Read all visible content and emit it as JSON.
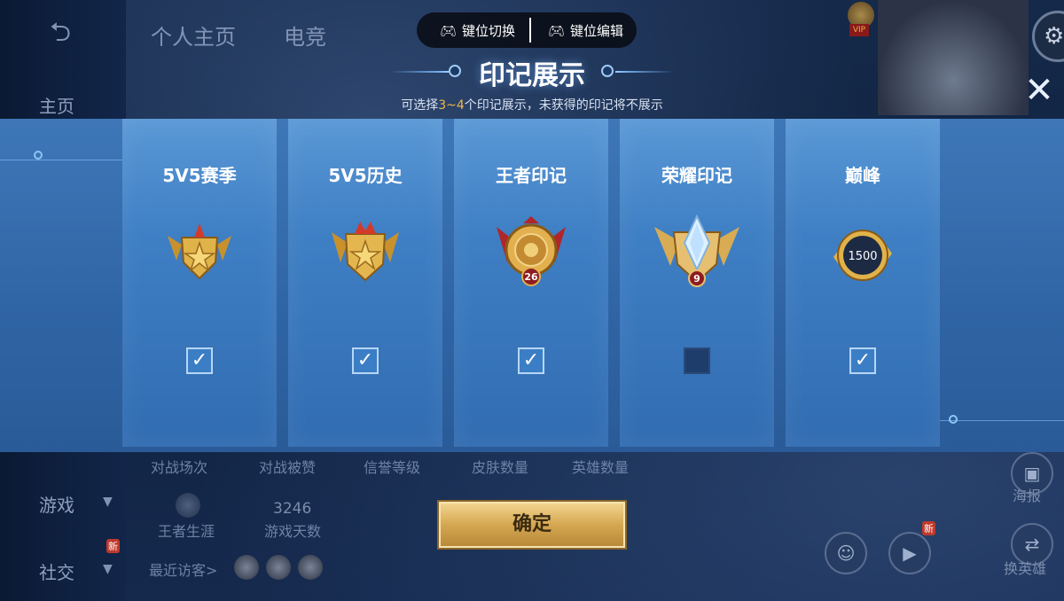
{
  "toolbar": {
    "key_switch_label": "键位切换",
    "key_edit_label": "键位编辑"
  },
  "dialog": {
    "title": "印记展示",
    "subtitle_prefix": "可选择",
    "subtitle_highlight": "3~4",
    "subtitle_suffix": "个印记展示，未获得的印记将不展示",
    "confirm_label": "确定"
  },
  "emblems": [
    {
      "label": "5V5赛季",
      "checked": true,
      "icon": "gold-crown-shield-icon"
    },
    {
      "label": "5V5历史",
      "checked": true,
      "icon": "gold-star-shield-icon"
    },
    {
      "label": "王者印记",
      "checked": true,
      "icon": "king-emblem-icon",
      "number": "26"
    },
    {
      "label": "荣耀印记",
      "checked": false,
      "icon": "glory-crystal-emblem-icon",
      "number": "9"
    },
    {
      "label": "巅峰",
      "checked": true,
      "icon": "peak-ring-icon",
      "number": "1500"
    }
  ],
  "background": {
    "top_tabs": [
      "个人主页",
      "电竞"
    ],
    "sidebar": {
      "home": "主页",
      "game": "游戏",
      "social": "社交",
      "new_badge": "新"
    },
    "stats_labels": [
      "对战场次",
      "对战被赞",
      "信誉等级",
      "皮肤数量",
      "英雄数量"
    ],
    "wangzhe_career": "王者生涯",
    "game_days_value": "3246",
    "game_days_label": "游戏天数",
    "recent_visitors": "最近访客>",
    "right_buttons": {
      "poster": "海报",
      "change_hero": "换英雄",
      "new_badge": "新"
    }
  },
  "colors": {
    "panel_blue": "#3e77b8",
    "card_blue": "#5a98d6",
    "highlight_orange": "#f2b84a",
    "confirm_gold": "#d5a751"
  }
}
